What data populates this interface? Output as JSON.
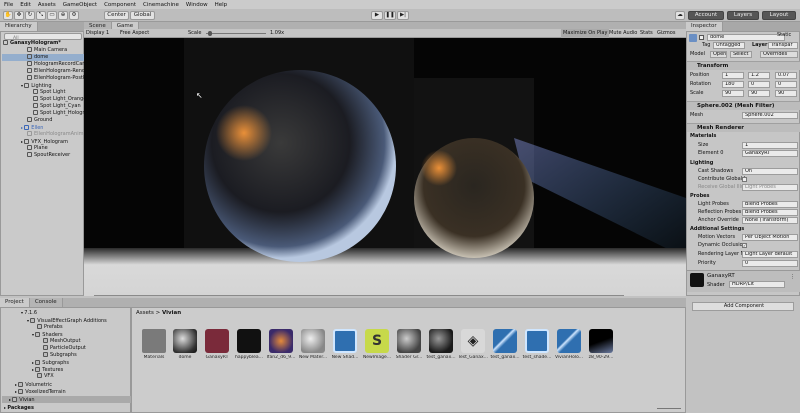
{
  "menu": [
    "File",
    "Edit",
    "Assets",
    "GameObject",
    "Component",
    "Cinemachine",
    "Window",
    "Help"
  ],
  "toolbar": {
    "center": "Center",
    "global": "Global",
    "account": "Account",
    "layers": "Layers",
    "layout": "Layout"
  },
  "hierarchy": {
    "tab": "Hierarchy",
    "search_placeholder": "All",
    "items": [
      "GanaxyHologram*",
      "Main Camera",
      "dome",
      "HologramRecordCam",
      "EllenHologram-Render",
      "EllenHologram-PostP",
      "Lighting",
      "Spot Light",
      "Spot Light_Orange",
      "Spot Light_Cyan",
      "Spot Light_Hologram",
      "Ground",
      "Ellen",
      "EllenHologramAnimat",
      "VFX_Hologram",
      "Plane",
      "SpoutReceiver"
    ]
  },
  "views": {
    "scene_tab": "Scene",
    "game_tab": "Game",
    "display": "Display 1",
    "aspect": "Free Aspect",
    "scale_label": "Scale",
    "scale_value": "1.09x",
    "maximize": "Maximize On Play",
    "mute": "Mute Audio",
    "stats": "Stats",
    "gizmos": "Gizmos"
  },
  "inspector": {
    "tab": "Inspector",
    "name": "dome",
    "static": "Static",
    "tag_label": "Tag",
    "tag": "Untagged",
    "layer_label": "Layer",
    "layer": "Transpar",
    "model": "Model",
    "open": "Open",
    "select": "Select",
    "overrides": "Overrides",
    "transform": {
      "title": "Transform",
      "position": "Position",
      "rotation": "Rotation",
      "scale": "Scale",
      "pos": {
        "x": "1",
        "y": "1.2",
        "z": "0.07"
      },
      "rot": {
        "x": "180",
        "y": "0",
        "z": "0"
      },
      "scl": {
        "x": "90",
        "y": "90",
        "z": "90"
      }
    },
    "meshfilter": {
      "title": "Sphere.002 (Mesh Filter)",
      "mesh_label": "Mesh",
      "mesh": "Sphere.002"
    },
    "renderer": {
      "title": "Mesh Renderer",
      "materials": "Materials",
      "size_label": "Size",
      "size": "1",
      "element0_label": "Element 0",
      "element0": "GanaxyRT",
      "lighting": "Lighting",
      "cast_label": "Cast Shadows",
      "cast": "On",
      "contribute": "Contribute Global I",
      "receive_label": "Receive Global Illu",
      "receive": "Light Probes",
      "probes": "Probes",
      "lightprobes_label": "Light Probes",
      "lightprobes": "Blend Probes",
      "reflprobes_label": "Reflection Probes",
      "reflprobes": "Blend Probes",
      "anchor_label": "Anchor Override",
      "anchor": "None (Transform)",
      "additional": "Additional Settings",
      "motion_label": "Motion Vectors",
      "motion": "Per Object Motion",
      "dynocc": "Dynamic Occlusion",
      "renderlayer_label": "Rendering Layer M",
      "renderlayer": "Light Layer default",
      "priority_label": "Priority",
      "priority": "0"
    },
    "material": {
      "name": "GanaxyRT",
      "shader_label": "Shader",
      "shader": "HDRP/Lit"
    },
    "add_component": "Add Component"
  },
  "project": {
    "project_tab": "Project",
    "console_tab": "Console",
    "tree": [
      "7.1.6",
      "VisualEffectGraph Additions",
      "Prefabs",
      "Shaders",
      "MeshOutput",
      "ParticleOutput",
      "Subgraphs",
      "Subgraphs",
      "Textures",
      "VFX",
      "Volumetric",
      "VoxelizedTerrain",
      "Vivian",
      "Packages"
    ],
    "breadcrumb_root": "Assets",
    "breadcrumb_sep": ">",
    "breadcrumb_leaf": "Vivian",
    "assets": [
      "Materials",
      "dome",
      "GanaxyRT",
      "happyblea...",
      "Ifan2_d6_9...",
      "New Mater...",
      "New Shad...",
      "NewImage...",
      "Shader Gr...",
      "test_ganax...",
      "Test_Ganax...",
      "test_ganax...",
      "test_shade...",
      "VivianHolo...",
      "z8_90-29..."
    ]
  }
}
